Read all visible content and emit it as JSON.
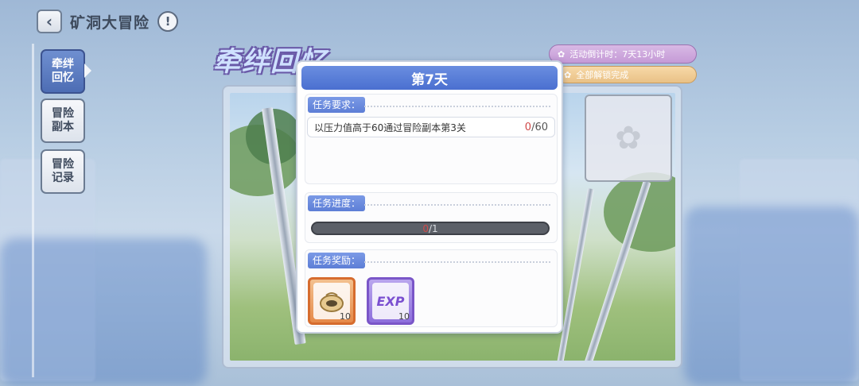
{
  "header": {
    "title": "矿洞大冒险",
    "back_icon": "chevron-left-icon",
    "info_icon": "exclamation-icon"
  },
  "sidebar": {
    "items": [
      {
        "label": "牵绊\n回忆",
        "active": true
      },
      {
        "label": "冒险\n副本",
        "active": false
      },
      {
        "label": "冒险\n记录",
        "active": false
      }
    ]
  },
  "banner": {
    "title": "牵绊回忆"
  },
  "event": {
    "countdown": "活动倒计时：7天13小时",
    "status": "全部解锁完成"
  },
  "modal": {
    "title": "第7天",
    "requirements": {
      "label": "任务要求：",
      "task_text": "以压力值高于60通过冒险副本第3关",
      "current": "0",
      "target": "/60"
    },
    "progress": {
      "label": "任务进度：",
      "current": "0",
      "target": "/1",
      "fraction": 0
    },
    "rewards": {
      "label": "任务奖励：",
      "items": [
        {
          "icon": "pouch-icon",
          "count": "10",
          "color": "#e58a4a"
        },
        {
          "icon": "exp-icon",
          "glyph": "EXP",
          "count": "10",
          "color": "#8d6fdc"
        }
      ]
    }
  },
  "colors": {
    "accent_blue": "#5d7ed6",
    "header_blue": "#4a6fd0",
    "progress_red": "#d04a4a"
  }
}
